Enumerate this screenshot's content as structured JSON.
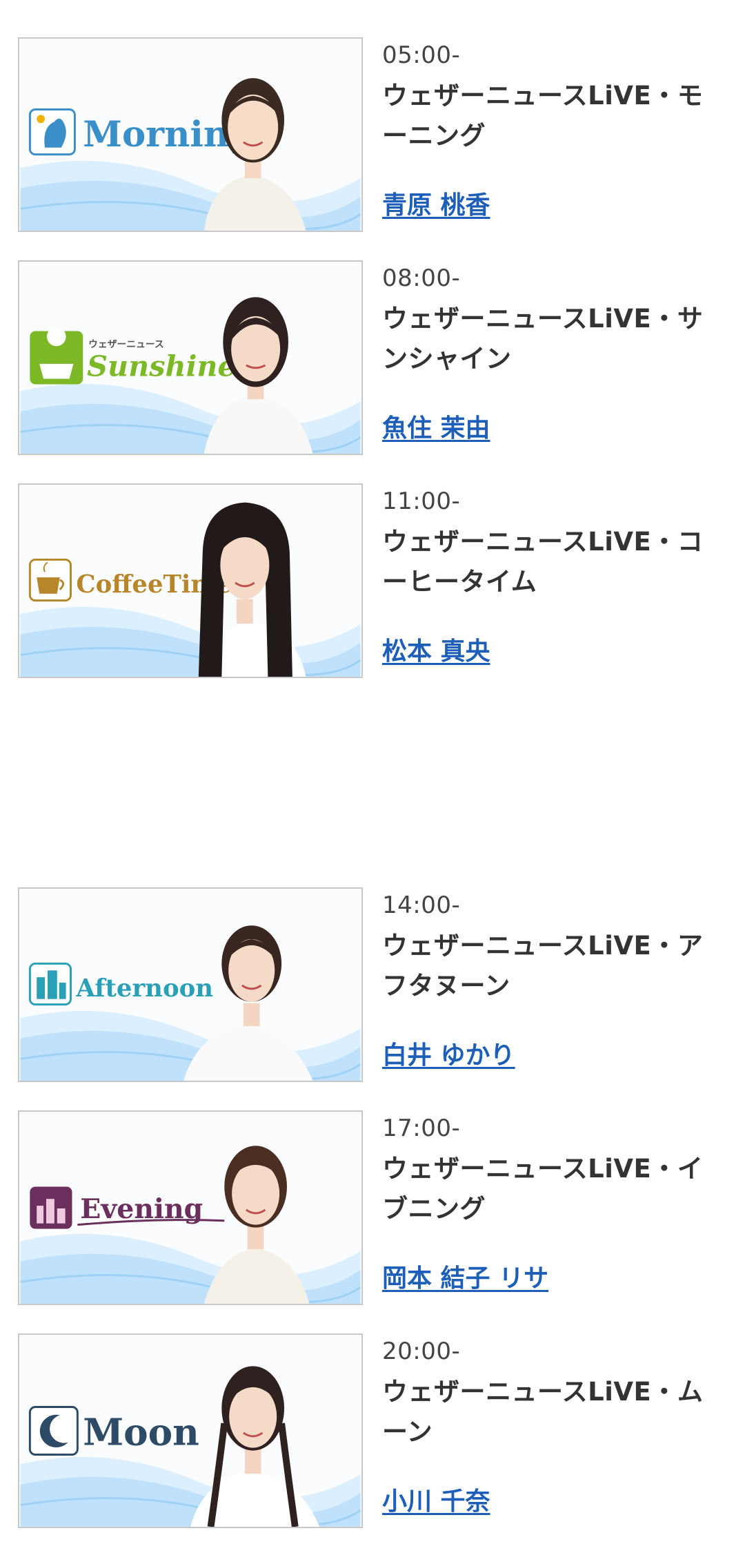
{
  "programs": [
    {
      "time": "05:00-",
      "title": "ウェザーニュースLiVE・モーニング",
      "caster": "青原 桃香",
      "logo": "Morning",
      "logo_color": "#3a8fc9",
      "logo_icon": "rooster-icon"
    },
    {
      "time": "08:00-",
      "title": "ウェザーニュースLiVE・サンシャイン",
      "caster": "魚住 茉由",
      "logo": "Sunshine",
      "logo_sub": "ウェザーニュース",
      "logo_color": "#7db826",
      "logo_icon": "sun-icon"
    },
    {
      "time": "11:00-",
      "title": "ウェザーニュースLiVE・コーヒータイム",
      "caster": "松本 真央",
      "logo": "CoffeeTime",
      "logo_color": "#b8862a",
      "logo_icon": "coffee-cup-icon"
    },
    {
      "time": "14:00-",
      "title": "ウェザーニュースLiVE・アフタヌーン",
      "caster": "白井 ゆかり",
      "logo": "Afternoon",
      "logo_color": "#2aa0b8",
      "logo_icon": "building-icon"
    },
    {
      "time": "17:00-",
      "title": "ウェザーニュースLiVE・イブニング",
      "caster": "岡本 結子 リサ",
      "logo": "Evening",
      "logo_color": "#6a2f5c",
      "logo_icon": "city-night-icon"
    },
    {
      "time": "20:00-",
      "title": "ウェザーニュースLiVE・ムーン",
      "caster": "小川 千奈",
      "logo": "Moon",
      "logo_color": "#2d4a66",
      "logo_icon": "moon-icon"
    }
  ]
}
